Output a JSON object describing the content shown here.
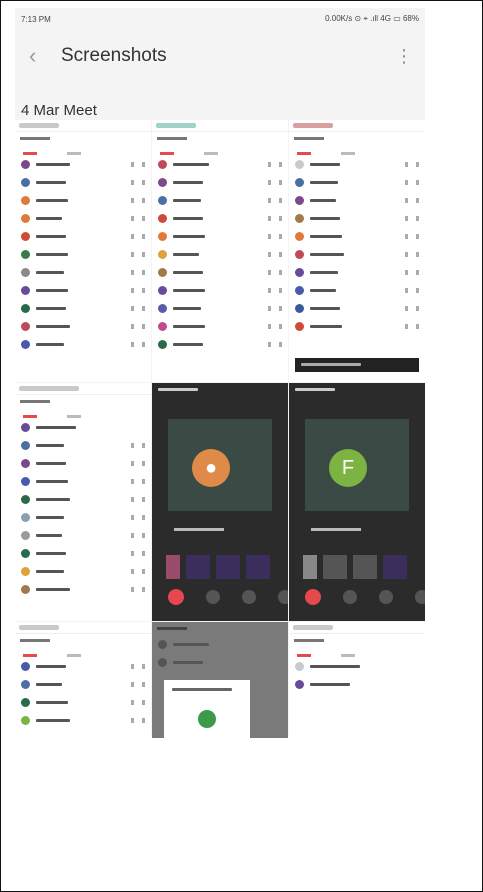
{
  "statusbar": {
    "time": "7:13 PM",
    "indicators": "0.00K/s ⊙ ⌖ .ıll 4G ▭ 68%"
  },
  "appbar": {
    "title": "Screenshots",
    "back_icon": "back-chevron-icon",
    "menu_icon": "more-vert-icon"
  },
  "section": {
    "label": "4 Mar  Meet"
  },
  "colors": {
    "accent_red": "#e64a4a",
    "meet_green": "#3c9a48",
    "avatar_green": "#7cb342"
  },
  "tiles": {
    "f_letter": "F"
  }
}
